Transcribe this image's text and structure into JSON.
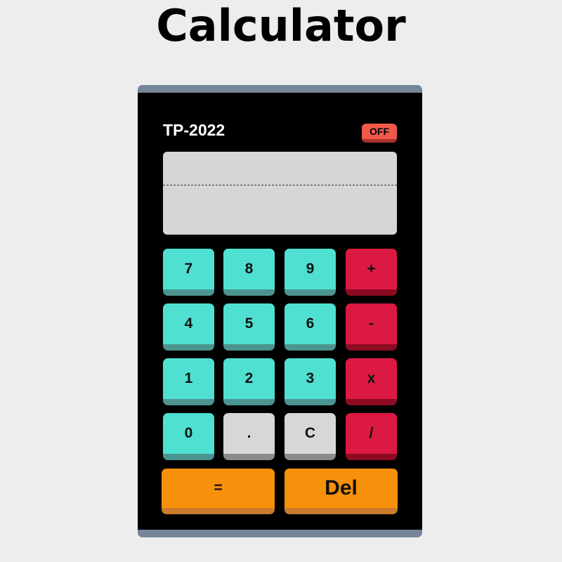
{
  "page": {
    "title": "Calculator"
  },
  "calculator": {
    "model": "TP-2022",
    "power_label": "OFF",
    "display": {
      "expression": "",
      "result": ""
    },
    "keys": {
      "k7": "7",
      "k8": "8",
      "k9": "9",
      "plus": "+",
      "k4": "4",
      "k5": "5",
      "k6": "6",
      "minus": "-",
      "k1": "1",
      "k2": "2",
      "k3": "3",
      "multiply": "x",
      "k0": "0",
      "dot": ".",
      "clear": "C",
      "divide": "/",
      "equals": "=",
      "delete": "Del"
    }
  },
  "colors": {
    "page_bg": "#ededed",
    "body": "#000000",
    "frame": "#76869a",
    "number_key": "#4fe0d2",
    "operator_key": "#dc1942",
    "gray_key": "#d7d7d7",
    "wide_key": "#f7900a",
    "power_button": "#f2594b",
    "screen": "#d6d6d6"
  }
}
